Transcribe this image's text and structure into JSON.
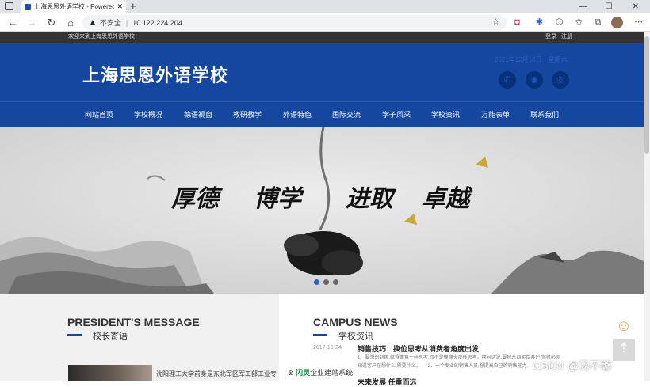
{
  "browser": {
    "tab_title": "上海思恩外语学校 - Powered by",
    "tab_close": "✕",
    "new_tab": "+",
    "url_warning": "不安全",
    "url_separator": "|",
    "url": "10.122.224.204",
    "win_minimize": "—",
    "win_maximize": "☐",
    "win_close": "✕"
  },
  "site": {
    "welcome": "欢迎来到上海思恩外语学校！",
    "login": "登录",
    "register": "注册",
    "logo": "上海思恩外语学校",
    "date": "2021年12月18日",
    "weekday": "星期六",
    "nav": [
      "网站首页",
      "学校概况",
      "德语视窗",
      "教研教学",
      "外语特色",
      "国际交流",
      "学子风采",
      "学校资讯",
      "万能表单",
      "联系我们"
    ],
    "slogan": [
      "厚德",
      "博学",
      "进取",
      "卓越"
    ],
    "president": {
      "en": "PRESIDENT'S MESSAGE",
      "zh": "校长寄语",
      "text": "沈阳理工大学前身是东北军区军工部工业专"
    },
    "news": {
      "en": "CAMPUS NEWS",
      "zh": "学校资讯",
      "date": "2017-10-24",
      "title": "销售技巧：换位思考从消费者角度出发",
      "summary_1": "1、要想钓到鱼,就得像鱼一样思考;而不是像渔夫那样思考。换句话说,要把东西卖给客户,你就必须",
      "summary_2": "知道客户在想什么,需要什么。　　2、一个专业的销售人员,想提高自己的销售能力,",
      "title_2": "未来发展 任重而远"
    },
    "brand_name": "闪灵",
    "brand_suffix": "企业建站系统",
    "watermark": "CSDN @汤不憨"
  },
  "colors": {
    "brand": "#1347a0",
    "strip": "#333333",
    "accent": "#f6a26b"
  }
}
